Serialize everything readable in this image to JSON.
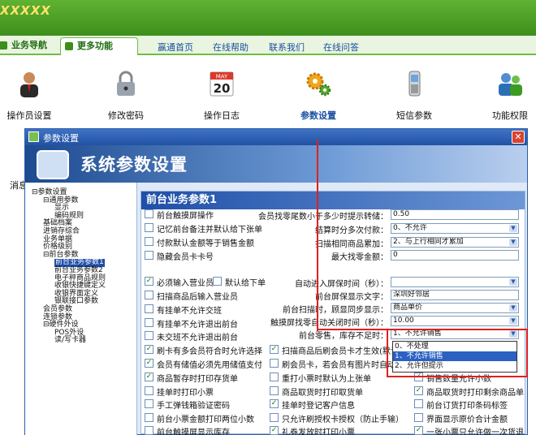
{
  "brand": "XXXXX",
  "tabs": [
    {
      "label": "业务导航",
      "active": false
    },
    {
      "label": "更多功能",
      "active": true
    }
  ],
  "nav_links": [
    "赢通首页",
    "在线帮助",
    "联系我们",
    "在线问答"
  ],
  "toolbar": [
    {
      "label": "操作员设置",
      "icon": "person-icon"
    },
    {
      "label": "修改密码",
      "icon": "padlock-icon"
    },
    {
      "label": "操作日志",
      "icon": "calendar-icon",
      "month": "MAY",
      "day": "20"
    },
    {
      "label": "参数设置",
      "icon": "gears-icon",
      "selected": true
    },
    {
      "label": "短信参数",
      "icon": "phone-icon"
    },
    {
      "label": "功能权限",
      "icon": "users-icon"
    }
  ],
  "hidden_left_label": "消息",
  "dialog": {
    "title": "参数设置",
    "close": "✕",
    "banner_title": "系统参数设置",
    "tree": [
      {
        "label": "参数设置",
        "level": 0,
        "mark": "⊟"
      },
      {
        "label": "通用参数",
        "level": 1,
        "mark": "⊟"
      },
      {
        "label": "显示",
        "level": 2
      },
      {
        "label": "编码规则",
        "level": 2
      },
      {
        "label": "基础档案",
        "level": 1
      },
      {
        "label": "进销存综合",
        "level": 1
      },
      {
        "label": "业务单据",
        "level": 1
      },
      {
        "label": "价格级别",
        "level": 1
      },
      {
        "label": "前台参数",
        "level": 1,
        "mark": "⊟"
      },
      {
        "label": "前台业务参数1",
        "level": 2,
        "selected": true
      },
      {
        "label": "前台业务参数2",
        "level": 2
      },
      {
        "label": "电子秤商品规则",
        "level": 2
      },
      {
        "label": "收银快捷键定义",
        "level": 2
      },
      {
        "label": "收银界面定义",
        "level": 2
      },
      {
        "label": "银联接口参数",
        "level": 2
      },
      {
        "label": "会员参数",
        "level": 1
      },
      {
        "label": "连锁参数",
        "level": 1
      },
      {
        "label": "硬件外设",
        "level": 1,
        "mark": "⊟"
      },
      {
        "label": "POS外设",
        "level": 2
      },
      {
        "label": "读/写卡器",
        "level": 2
      }
    ],
    "panel_title": "前台业务参数1",
    "left_checks": [
      {
        "label": "前台触摸屏操作",
        "checked": false
      },
      {
        "label": "记忆前台备注并默认给下张单",
        "checked": false
      },
      {
        "label": "付款默认金额等于销售金额",
        "checked": false
      },
      {
        "label": "隐藏会员卡卡号",
        "checked": false
      },
      {
        "label": "必须输入营业员",
        "checked": true
      },
      {
        "label": "扫描商品后输入营业员",
        "checked": false
      },
      {
        "label": "有挂单不允许交班",
        "checked": false
      },
      {
        "label": "有挂单不允许退出前台",
        "checked": false
      },
      {
        "label": "未交班不允许退出前台",
        "checked": false
      },
      {
        "label": "刷卡有多会员符合时允许选择",
        "checked": true
      },
      {
        "label": "会员有储值必须先用储值支付",
        "checked": true
      },
      {
        "label": "商品暂存时打印存货单",
        "checked": true
      },
      {
        "label": "挂单时打印小票",
        "checked": false
      },
      {
        "label": "手工弹钱箱验证密码",
        "checked": false
      },
      {
        "label": "前台小票金额打印两位小数",
        "checked": false
      },
      {
        "label": "前台触摸屏显示库存",
        "checked": false
      }
    ],
    "default_pending": {
      "label": "默认给下单",
      "checked": false
    },
    "form_rows": [
      {
        "label": "会员找零尾数小于多少时提示转储：",
        "value": "0.50",
        "dropdown": false
      },
      {
        "label": "结算时分多次付款：",
        "value": "0、不允许",
        "dropdown": true
      },
      {
        "label": "扫描相同商品累加：",
        "value": "2、与上行相同才累加",
        "dropdown": true
      },
      {
        "label": "最大找零金额：",
        "value": "0",
        "dropdown": false
      },
      {
        "label": "自动进入屏保时间（秒）：",
        "value": "",
        "dropdown": true
      },
      {
        "label": "前台屏保显示文字：",
        "value": "深圳好邻居",
        "dropdown": false
      },
      {
        "label": "前台扫描时，顾显同步显示：",
        "value": "商品单价",
        "dropdown": true
      },
      {
        "label": "触摸屏找零自动关闭时间（秒）：",
        "value": "10.00",
        "dropdown": true
      },
      {
        "label": "前台零售，库存不足时：",
        "value": "1、不允许销售",
        "dropdown": true
      }
    ],
    "mid_checks": [
      {
        "label": "扫描商品后刷会员卡才生效(默认)",
        "checked": true
      },
      {
        "label": "刷会员卡，若会员有图片时自动显示",
        "checked": false
      },
      {
        "label": "重打小票时默认为上张单",
        "checked": false
      },
      {
        "label": "商品取货时打印取货单",
        "checked": false
      },
      {
        "label": "挂单时登记客户信息",
        "checked": true
      },
      {
        "label": "只允许刷授权卡授权（防止手输）",
        "checked": false
      },
      {
        "label": "礼券发放时打印小票",
        "checked": true
      }
    ],
    "right_checks": [
      {
        "label": "销售数量允许小数",
        "checked": true
      },
      {
        "label": "商品取货时打印剩余商品单",
        "checked": true
      },
      {
        "label": "前台订货打印条码标签",
        "checked": false
      },
      {
        "label": "界面显示原价合计金额",
        "checked": false
      },
      {
        "label": "一张小票只允许做一次货退",
        "checked": true
      }
    ],
    "stock_options": [
      "0、不处理",
      "1、不允许销售",
      "2、允许但提示"
    ],
    "stock_selected_index": 1
  },
  "colors": {
    "green": "#3d8f1c",
    "blue": "#1f4fa8",
    "highlight_red": "#e02020"
  }
}
